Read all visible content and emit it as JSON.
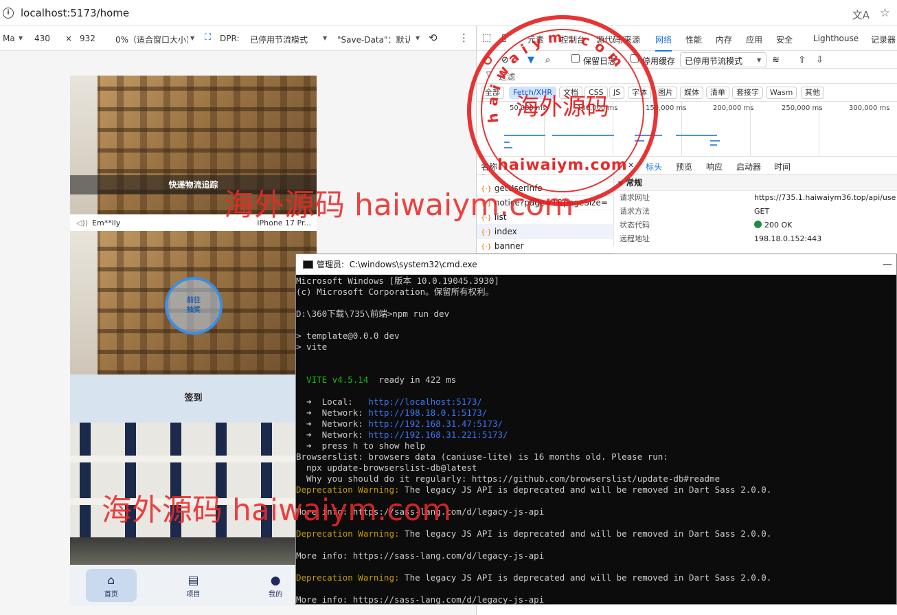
{
  "browser": {
    "url": "localhost:5173/home"
  },
  "device_toolbar": {
    "dimensions_label": "Ma",
    "width": "430",
    "times": "×",
    "height": "932",
    "zoom": "0%（适合窗口大小）",
    "dpr": "DPR:",
    "throttle": "已停用节流模式",
    "save_data": "\"Save-Data\"：默认"
  },
  "app": {
    "banner_title": "快递物流追踪",
    "notice_user": "Em**ily",
    "notice_device": "iPhone 17 Pr...",
    "circle_button_line1": "前往",
    "circle_button_line2": "抽奖",
    "signin_label": "签到",
    "tabs": [
      {
        "label": "首页",
        "active": true
      },
      {
        "label": "项目",
        "active": false
      },
      {
        "label": "我的",
        "active": false
      }
    ]
  },
  "devtools": {
    "tabs": [
      "元素",
      "控制台",
      "源代码/来源",
      "网络",
      "性能",
      "内存",
      "应用",
      "安全",
      "Lighthouse",
      "记录器"
    ],
    "active_tab": "网络",
    "preserve_log": "保留日志",
    "disable_cache": "停用缓存",
    "throttle": "已停用节流模式",
    "filter_label": "过滤",
    "types": [
      "全部",
      "Fetch/XHR",
      "文档",
      "CSS",
      "JS",
      "字体",
      "图片",
      "媒体",
      "清单",
      "套接字",
      "Wasm",
      "其他"
    ],
    "timeline_labels": [
      "50,000 ms",
      "100,000 ms",
      "150,000 ms",
      "200,000 ms",
      "250,000 ms",
      "300,000 ms"
    ],
    "list_header": "名称",
    "detail_tabs": [
      "标头",
      "预览",
      "响应",
      "启动器",
      "时间"
    ],
    "requests": [
      "getUserInfo",
      "getUserInfo",
      "notice?page=1&pageSize=",
      "list",
      "index",
      "banner"
    ],
    "general_section": "常规",
    "general": [
      {
        "k": "请求网址",
        "v": "https://735.1.haiwaiym36.top/api/use"
      },
      {
        "k": "请求方法",
        "v": "GET"
      },
      {
        "k": "状态代码",
        "v": "200 OK"
      },
      {
        "k": "远程地址",
        "v": "198.18.0.152:443"
      }
    ]
  },
  "cmd": {
    "title_prefix": "管理员:",
    "title": "C:\\windows\\system32\\cmd.exe",
    "lines": [
      "Microsoft Windows [版本 10.0.19045.3930]",
      "(c) Microsoft Corporation。保留所有权利。",
      "",
      "D:\\360下载\\735\\前端>npm run dev",
      "",
      "> template@0.0.0 dev",
      "> vite",
      "",
      "",
      "  VITE v4.5.14  ready in 422 ms",
      "",
      "  ➜  Local:   http://localhost:5173/",
      "  ➜  Network: http://198.18.0.1:5173/",
      "  ➜  Network: http://192.168.31.47:5173/",
      "  ➜  Network: http://192.168.31.221:5173/",
      "  ➜  press h to show help",
      "Browserslist: browsers data (caniuse-lite) is 16 months old. Please run:",
      "  npx update-browserslist-db@latest",
      "  Why you should do it regularly: https://github.com/browserslist/update-db#readme",
      "Deprecation Warning: The legacy JS API is deprecated and will be removed in Dart Sass 2.0.0.",
      "",
      "More info: https://sass-lang.com/d/legacy-js-api",
      "",
      "Deprecation Warning: The legacy JS API is deprecated and will be removed in Dart Sass 2.0.0.",
      "",
      "More info: https://sass-lang.com/d/legacy-js-api",
      "",
      "Deprecation Warning: The legacy JS API is deprecated and will be removed in Dart Sass 2.0.0.",
      "",
      "More info: https://sass-lang.com/d/legacy-js-api"
    ]
  },
  "watermark": {
    "cn": "海外源码",
    "en": "haiwaiym.com",
    "stamp_cn": "海外源码",
    "stamp_en": "haiwaiym.com"
  }
}
